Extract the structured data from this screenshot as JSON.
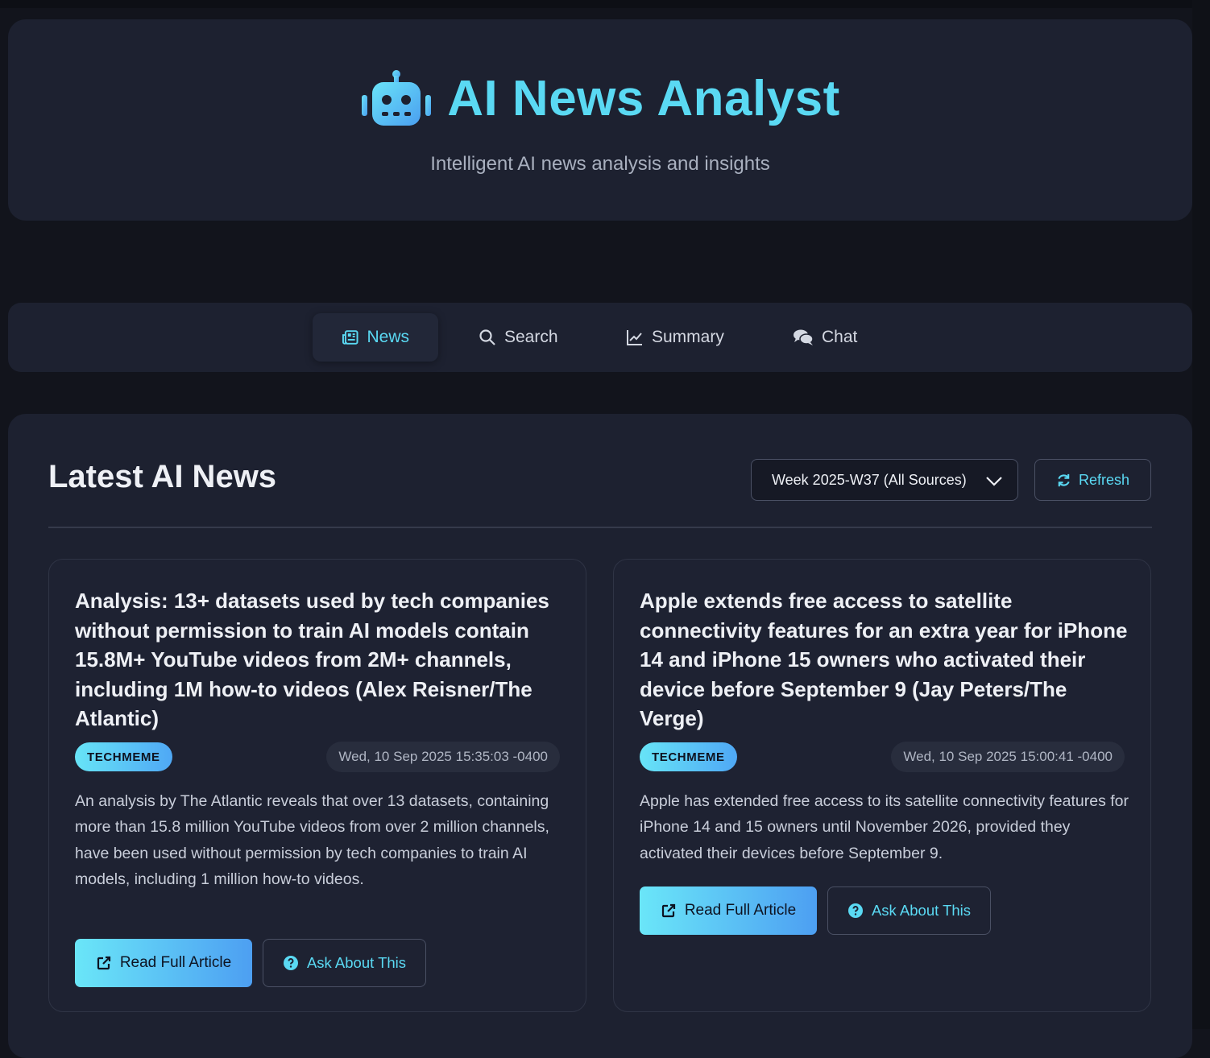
{
  "colors": {
    "accent": "#5ad9f3",
    "background": "#12141c",
    "surface": "#1d2130",
    "badge_gradient": [
      "#67e4f7",
      "#4fa8f5"
    ]
  },
  "header": {
    "icon": "robot-icon",
    "title": "AI News Analyst",
    "subtitle": "Intelligent AI news analysis and insights"
  },
  "nav": {
    "tabs": [
      {
        "label": "News",
        "icon": "newspaper-icon",
        "active": true
      },
      {
        "label": "Search",
        "icon": "search-icon",
        "active": false
      },
      {
        "label": "Summary",
        "icon": "line-chart-icon",
        "active": false
      },
      {
        "label": "Chat",
        "icon": "chat-bubbles-icon",
        "active": false
      }
    ]
  },
  "main": {
    "title": "Latest AI News",
    "week_select": {
      "value": "Week 2025-W37 (All Sources)"
    },
    "refresh_label": "Refresh",
    "articles": [
      {
        "title": "Analysis: 13+ datasets used by tech companies without permission to train AI models contain 15.8M+ YouTube videos from 2M+ channels, including 1M how-to videos (Alex Reisner/The Atlantic)",
        "source": "TECHMEME",
        "date": "Wed, 10 Sep 2025 15:35:03 -0400",
        "description": "An analysis by The Atlantic reveals that over 13 datasets, containing more than 15.8 million YouTube videos from over 2 million channels, have been used without permission by tech companies to train AI models, including 1 million how-to videos.",
        "read_label": "Read Full Article",
        "ask_label": "Ask About This"
      },
      {
        "title": "Apple extends free access to satellite connectivity features for an extra year for iPhone 14 and iPhone 15 owners who activated their device before September 9 (Jay Peters/The Verge)",
        "source": "TECHMEME",
        "date": "Wed, 10 Sep 2025 15:00:41 -0400",
        "description": "Apple has extended free access to its satellite connectivity features for iPhone 14 and 15 owners until November 2026, provided they activated their devices before September 9.",
        "read_label": "Read Full Article",
        "ask_label": "Ask About This"
      }
    ]
  }
}
